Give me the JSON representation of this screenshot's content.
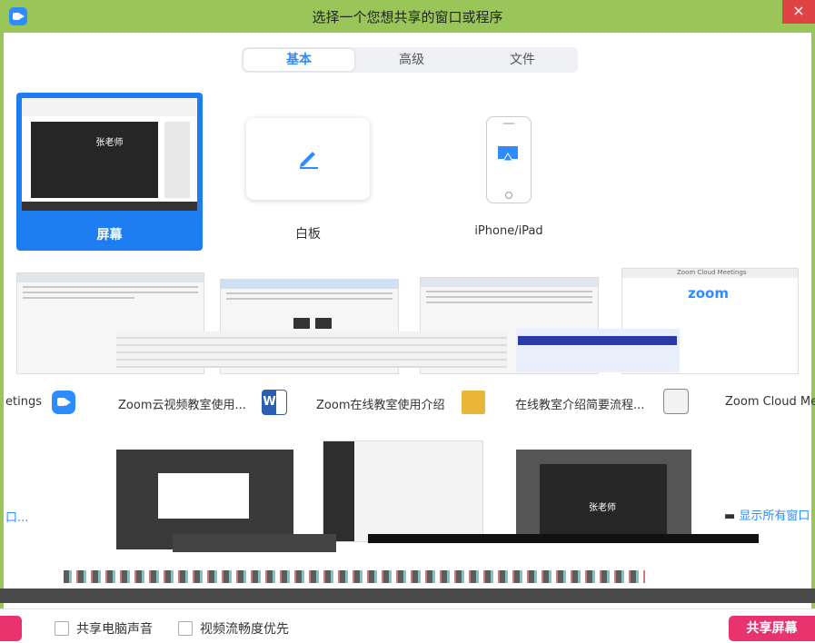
{
  "window": {
    "title": "选择一个您想共享的窗口或程序",
    "close_label": "×"
  },
  "tabs": [
    {
      "label": "基本"
    },
    {
      "label": "高级"
    },
    {
      "label": "文件"
    }
  ],
  "sources": {
    "screen": {
      "label": "屏幕",
      "thumb_text": "张老师"
    },
    "whiteboard": {
      "label": "白板"
    },
    "iphone": {
      "label": "iPhone/iPad"
    }
  },
  "windows_row1": [
    {
      "label": "etings"
    },
    {
      "label": "Zoom云视频教室使用..."
    },
    {
      "label": "Zoom在线教室使用介绍"
    },
    {
      "label": "在线教室介绍简要流程..."
    },
    {
      "label": "Zoom Cloud Me"
    }
  ],
  "zoom_logo": "zoom",
  "zoom_cloud_title": "Zoom Cloud Meetings",
  "word_letter": "W",
  "row2": {
    "left_text": "口...",
    "thumb_text": "张老师",
    "show_all": "显示所有窗口"
  },
  "footer": {
    "share_audio": "共享电脑声音",
    "optimize_video": "视频流畅度优先",
    "share_button": "共享屏幕"
  }
}
